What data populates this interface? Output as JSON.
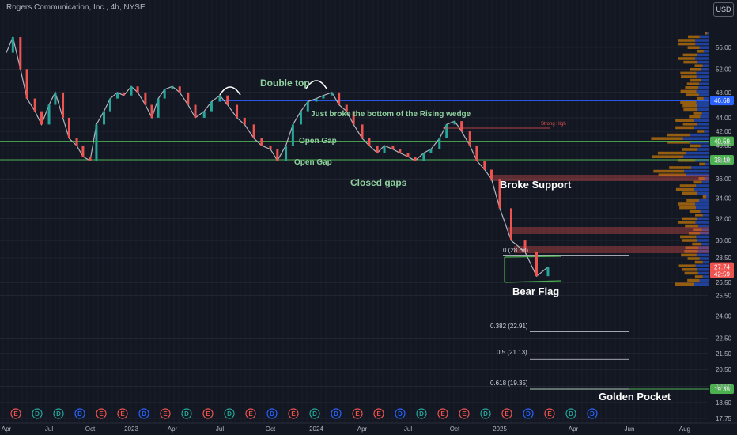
{
  "header": {
    "title": "Rogers Communication, Inc., 4h, NYSE",
    "currency": "USD"
  },
  "chart_data": {
    "type": "line",
    "title": "Rogers Communication, Inc., 4h, NYSE",
    "x_ticks": [
      "Apr",
      "Jul",
      "Oct",
      "2023",
      "Apr",
      "Jul",
      "Oct",
      "2024",
      "Apr",
      "Jul",
      "Oct",
      "2025",
      "Apr",
      "Jun",
      "Aug"
    ],
    "y_ticks": [
      17.75,
      18.6,
      19.5,
      20.5,
      21.5,
      22.5,
      24.0,
      25.5,
      26.5,
      28.5,
      30.0,
      32.0,
      34.0,
      36.0,
      38.0,
      40.0,
      42.0,
      44.0,
      48.0,
      52.0,
      56.0
    ],
    "ylim": [
      17.4,
      60
    ],
    "ylog": true,
    "series": [
      {
        "x": [
          "2022-04-01",
          "2022-04-15",
          "2022-05-01",
          "2022-05-15",
          "2022-06-01",
          "2022-06-15",
          "2022-07-01",
          "2022-07-15",
          "2022-08-01",
          "2022-08-15",
          "2022-09-01",
          "2022-09-15",
          "2022-10-01",
          "2022-10-15",
          "2022-11-01",
          "2022-11-15",
          "2022-12-01",
          "2022-12-15",
          "2023-01-01",
          "2023-01-15",
          "2023-02-01",
          "2023-02-15",
          "2023-03-01",
          "2023-03-15",
          "2023-04-01",
          "2023-04-15",
          "2023-05-01",
          "2023-05-15",
          "2023-06-01",
          "2023-06-15",
          "2023-07-01",
          "2023-07-15",
          "2023-08-01",
          "2023-08-15",
          "2023-09-01",
          "2023-09-15",
          "2023-10-01",
          "2023-10-15",
          "2023-11-01",
          "2023-11-15",
          "2023-12-01",
          "2023-12-15",
          "2024-01-01",
          "2024-01-15",
          "2024-02-01",
          "2024-02-15",
          "2024-03-01",
          "2024-03-15",
          "2024-04-01",
          "2024-04-15",
          "2024-05-01",
          "2024-05-15",
          "2024-06-01",
          "2024-06-15",
          "2024-07-01",
          "2024-07-15",
          "2024-08-01",
          "2024-08-15",
          "2024-09-01",
          "2024-09-15",
          "2024-10-01",
          "2024-10-15",
          "2024-11-01",
          "2024-11-15",
          "2024-12-01",
          "2024-12-15",
          "2025-01-01",
          "2025-01-15",
          "2025-02-01",
          "2025-02-15",
          "2025-03-01"
        ],
        "values": [
          55,
          58,
          52,
          47,
          45,
          43,
          46,
          48,
          44,
          41,
          40,
          38.5,
          38,
          43,
          45,
          47,
          48,
          47.5,
          49,
          48,
          46,
          44,
          47,
          48.5,
          49,
          48,
          46,
          44,
          45,
          46.5,
          47.5,
          46,
          44,
          43,
          41,
          40,
          39.5,
          38,
          40,
          43,
          45,
          46.5,
          47,
          47.5,
          48,
          46,
          45,
          43,
          41,
          40,
          39,
          40,
          39.5,
          39,
          38.5,
          38,
          39,
          39.5,
          41,
          43,
          43.5,
          42,
          40,
          38,
          37,
          36,
          33,
          30,
          29,
          27,
          27.74
        ]
      }
    ],
    "fib_levels": [
      {
        "label": "0 (28.68)",
        "value": 28.68
      },
      {
        "label": "0.382 (22.91)",
        "value": 22.91
      },
      {
        "label": "0.5 (21.13)",
        "value": 21.13
      },
      {
        "label": "0.618 (19.35)",
        "value": 19.35
      }
    ],
    "horizontal_levels": [
      {
        "label": "46.68",
        "value": 46.68,
        "color": "#2962ff"
      },
      {
        "label": "40.59",
        "value": 40.59,
        "color": "#4caf50"
      },
      {
        "label": "38.10",
        "value": 38.1,
        "color": "#4caf50"
      },
      {
        "label": "19.35",
        "value": 19.35,
        "color": "#4caf50"
      }
    ],
    "current_price": {
      "label": "27.74",
      "value": 27.74,
      "countdown": "42:59"
    },
    "annotations": {
      "double_top": "Double top",
      "rising_wedge": "Just broke the bottom of the Rising wedge",
      "open_gap_1": "Open Gap",
      "open_gap_2": "Open Gap",
      "closed_gaps": "Closed gaps",
      "broke_support": "Broke Support",
      "bear_flag": "Bear Flag",
      "golden_pocket": "Golden Pocket",
      "strong_high": "Strong High"
    },
    "events": [
      "E",
      "D",
      "D",
      "D",
      "E",
      "E",
      "D",
      "E",
      "D",
      "E",
      "D",
      "E",
      "D",
      "E",
      "D",
      "D",
      "E",
      "E",
      "D",
      "D",
      "E",
      "E",
      "D",
      "E",
      "D",
      "E",
      "D",
      "D",
      "E"
    ],
    "colors": {
      "up": "#26a69a",
      "down": "#ef5350",
      "bg": "#131722",
      "grid": "#2a2e39",
      "blue": "#2962ff",
      "green": "#4caf50",
      "profile": "#ff9800",
      "profile_blue": "#2962ff"
    }
  }
}
